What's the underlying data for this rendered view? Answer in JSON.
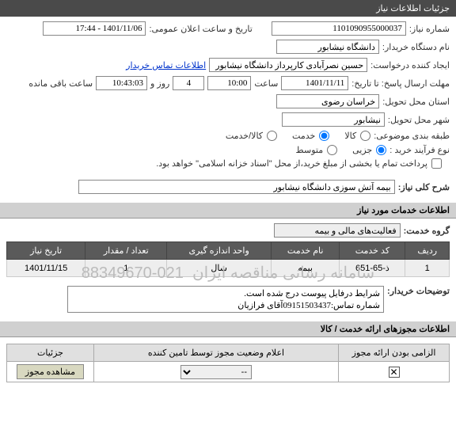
{
  "header": {
    "title": "جزئیات اطلاعات نیاز"
  },
  "form": {
    "need_no_label": "شماره نیاز:",
    "need_no_value": "1101090955000037",
    "announce_date_label": "تاریخ و ساعت اعلان عمومی:",
    "announce_date_value": "1401/11/06 - 17:44",
    "buyer_org_label": "نام دستگاه خریدار:",
    "buyer_org_value": "دانشگاه نیشابور",
    "requester_label": "ایجاد کننده درخواست:",
    "requester_value": "حسین نصرآبادی کارپرداز دانشگاه نیشابور",
    "contact_link": "اطلاعات تماس خریدار",
    "deadline_label": "مهلت ارسال پاسخ: تا تاریخ:",
    "deadline_date": "1401/11/11",
    "hour_label": "ساعت",
    "deadline_hour": "10:00",
    "day_label": "روز و",
    "days_remain": "4",
    "remain_time": "10:43:03",
    "remain_label": "ساعت باقی مانده",
    "province_label": "استان محل تحویل:",
    "province_value": "خراسان رضوی",
    "city_label": "شهر محل تحویل:",
    "city_value": "نیشابور",
    "subject_class_label": "طبقه بندی موضوعی:",
    "rb_goods": "کالا",
    "rb_service": "خدمت",
    "rb_goods_service": "کالا/خدمت",
    "process_type_label": "نوع فرآیند خرید :",
    "rb_minor": "جزیی",
    "rb_medium": "متوسط",
    "payment_note": "پرداخت تمام یا بخشی از مبلغ خرید،از محل \"اسناد خزانه اسلامی\" خواهد بود.",
    "desc_label": "شرح کلی نیاز:",
    "desc_value": "بیمه آتش سوزی دانشگاه نیشابور"
  },
  "services": {
    "section_title": "اطلاعات خدمات مورد نیاز",
    "group_label": "گروه خدمت:",
    "group_value": "فعالیت‌های مالی و بیمه",
    "headers": {
      "row": "ردیف",
      "code": "کد خدمت",
      "name": "نام خدمت",
      "unit": "واحد اندازه گیری",
      "qty": "تعداد / مقدار",
      "date": "تاریخ نیاز"
    },
    "row": {
      "idx": "1",
      "code": "ذ-65-651",
      "name": "بیمه",
      "unit": "سال",
      "qty": "1",
      "date": "1401/11/15"
    }
  },
  "watermark": "سامانه رسانی مناقصه ایران",
  "watermark_num": "021-88349670",
  "buyer_notes": {
    "label": "توضیحات خریدار:",
    "line1": "شرایط درفایل پیوست درج شده است.",
    "line2": "شماره تماس:09151503437آقای فرازیان"
  },
  "service_permits": {
    "section_title": "اطلاعات مجوزهای ارائه خدمت / کالا",
    "headers": {
      "required": "الزامی بودن ارائه مجوز",
      "status": "اعلام وضعیت مجوز توسط تامین کننده",
      "details": "جزئیات"
    },
    "row": {
      "status_selected": "--",
      "details_btn": "مشاهده مجوز"
    }
  }
}
